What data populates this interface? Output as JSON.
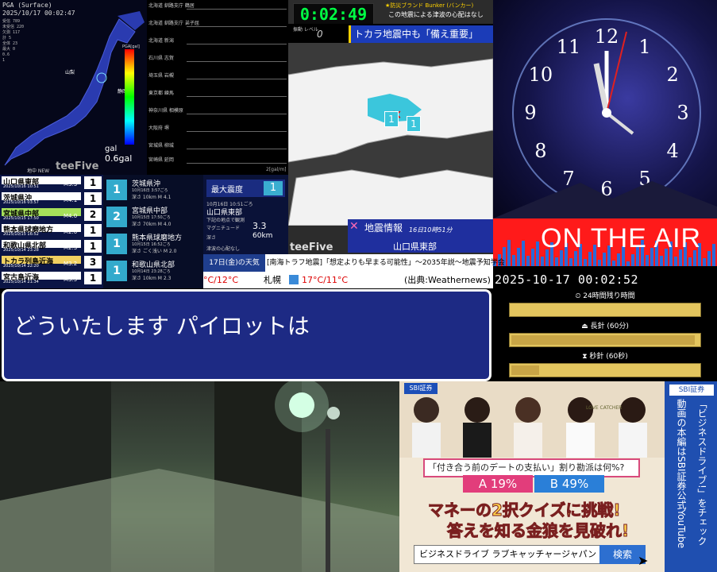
{
  "seismic": {
    "header": "PGA (Surface)",
    "timestamp": "2025/10/17 00:02:47",
    "stats": [
      "受信 789",
      "未受信 220",
      "欠測 117",
      "計 5",
      "全体 23",
      "最大 0",
      "0.6",
      "1"
    ],
    "scale_label": "PGA[gal]",
    "gal_a": "0.6gal",
    "gal_b": "gal",
    "brand": "teeFive",
    "map_labels": [
      "山梨",
      "静岡"
    ]
  },
  "waveforms": {
    "stations": [
      "北海道 釧路支庁 鶴居",
      "北海道 釧路支庁 弟子屈",
      "北海道 新潟",
      "石川県 志賀",
      "埼玉県 岩槻",
      "東京都 練馬",
      "神奈川県 相模原",
      "大阪府 堺",
      "宮城県 柳城",
      "宮崎県 延岡"
    ],
    "footer": "2[gal/m]"
  },
  "timer": {
    "value": "0:02:49",
    "bunker": "★防災ブランド Bunker (バンカー)",
    "tsunami": "この地震による津波の心配はなし",
    "level_label": "振動 レベル",
    "level_value": "0",
    "headline": "トカラ地震中も「備え重要」"
  },
  "eq_info": {
    "title": "地震情報",
    "datetime": "16日10時51分",
    "location": "山口県東部",
    "brand": "teeFive",
    "markers": [
      "1",
      "1"
    ]
  },
  "clock": {
    "numbers": [
      "12",
      "1",
      "2",
      "3",
      "4",
      "5",
      "6",
      "7",
      "8",
      "9",
      "10",
      "11"
    ]
  },
  "onair": {
    "text": "ON THE AIR"
  },
  "progress": {
    "datetime": "2025-10-17 00:02:52",
    "bars": [
      {
        "label": "24時間残り時間",
        "icon": "clock-icon",
        "value": 0.0
      },
      {
        "label": "長針 (60分)",
        "icon": "hand-long-icon",
        "value": 0.98
      },
      {
        "label": "秒針 (60秒)",
        "icon": "hourglass-icon",
        "value": 0.15
      }
    ]
  },
  "intensity_list": {
    "header": "地中 NEW",
    "items": [
      {
        "name": "山口県東部",
        "date": "2025/10/16 10:51",
        "mag": "M3.3",
        "intensity": "1",
        "color": "#ffffff"
      },
      {
        "name": "茨城県沖",
        "date": "2025/10/16 03:57",
        "mag": "M4.1",
        "intensity": "1",
        "color": "#ffffff"
      },
      {
        "name": "宮城県中部",
        "date": "2025/10/15 17:50",
        "mag": "M4.0",
        "intensity": "2",
        "color": "#a6e05a"
      },
      {
        "name": "熊本県球磨地方",
        "date": "2025/10/15 16:52",
        "mag": "M2.0",
        "intensity": "1",
        "color": "#ffffff"
      },
      {
        "name": "和歌山県北部",
        "date": "2025/10/14 23:28",
        "mag": "M2.3",
        "intensity": "1",
        "color": "#ffffff"
      },
      {
        "name": "トカラ列島近海",
        "date": "2025/10/14 22:20",
        "mag": "M3.2",
        "intensity": "3",
        "color": "#f0d060"
      },
      {
        "name": "宮古島近海",
        "date": "2025/10/14 21:34",
        "mag": "M3.5",
        "intensity": "1",
        "color": "#ffffff"
      }
    ]
  },
  "detail": {
    "items": [
      {
        "name": "茨城県沖",
        "date": "10月16日 3:57ごろ",
        "depth": "深さ 10km",
        "mag": "M 4.1",
        "intensity": "1"
      },
      {
        "name": "宮城県中部",
        "date": "10月15日 17:50ごろ",
        "depth": "深さ 70km",
        "mag": "M 4.0",
        "intensity": "2"
      },
      {
        "name": "熊本県球磨地方",
        "date": "10月15日 16:52ごろ",
        "depth": "深さ ごく浅い",
        "mag": "M 2.0",
        "intensity": "1"
      },
      {
        "name": "和歌山県北部",
        "date": "10月14日 23:28ごろ",
        "depth": "深さ 10km",
        "mag": "M 2.3",
        "intensity": "1"
      }
    ]
  },
  "max_intensity": {
    "label": "最大震度",
    "value": "1",
    "date": "10月16日 10:51ごろ",
    "location": "山口県東部",
    "caption": "下記の地点で観測",
    "magnitude_label": "マグニチュード",
    "magnitude": "3.3",
    "depth_label": "深さ",
    "depth": "60km",
    "tsunami": "津波の心配なし"
  },
  "ticker": {
    "date": "17日(金)の天気",
    "news": "[南海トラフ地震]「想定よりも早まる可能性」～2035年説～地震予知学会",
    "temp1": "°C/12°C",
    "city": "札幌",
    "temp2": "17°C/11°C",
    "source": "(出典:Weathernews)"
  },
  "dialog": {
    "text": "どういたします パイロットは"
  },
  "ad": {
    "brand": "SBI証券",
    "question": "「付き合う前のデートの支払い」割り勘派は何%?",
    "answer_a": "A 19%",
    "answer_b": "B 49%",
    "headline1": "マネーの2択クイズに挑戦!",
    "headline2": "答えを知る金狼を見破れ!",
    "search_value": "ビジネスドライブ ラブキャッチャージャパン",
    "search_button": "検索",
    "side_badge": "SBI証券",
    "side_text1": "動画の本編は",
    "side_text2": "SBI証券公式YouTube",
    "side_text3": "「ビジネスドライブ!」をチェック",
    "show_logo": "LOVE CATCHER"
  },
  "colors": {
    "accent_red": "#ff1a1a",
    "timer_green": "#00ff44",
    "panel_blue": "#1d2a84"
  }
}
